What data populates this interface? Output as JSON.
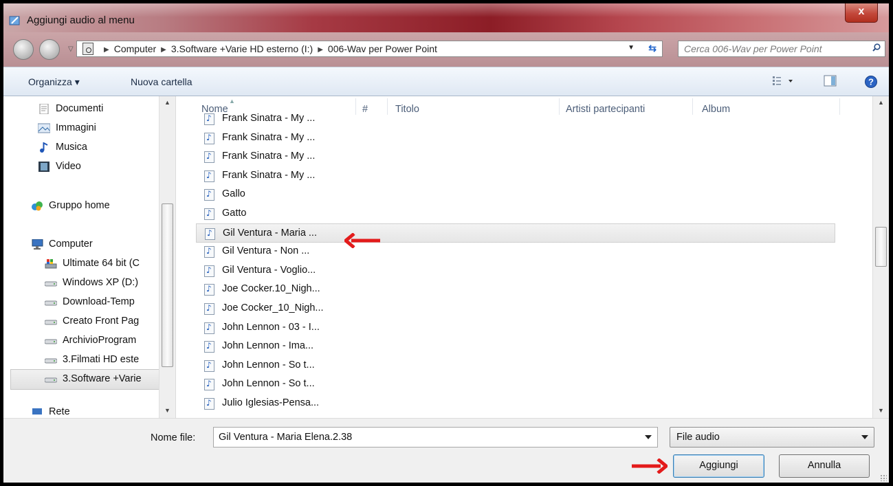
{
  "window": {
    "title": "Aggiungi audio al menu",
    "close_glyph": "x"
  },
  "navigation": {
    "breadcrumbs": [
      "Computer",
      "3.Software +Varie HD esterno (I:)",
      "006-Wav per Power Point"
    ],
    "search_placeholder": "Cerca 006-Wav per Power Point"
  },
  "toolbar": {
    "organize_label": "Organizza ▾",
    "new_folder_label": "Nuova cartella"
  },
  "sidebar": {
    "libraries": [
      "Documenti",
      "Immagini",
      "Musica",
      "Video"
    ],
    "homegroup": "Gruppo home",
    "computer": "Computer",
    "drives": [
      "Ultimate 64 bit (C",
      "Windows XP (D:)",
      "Download-Temp",
      "Creato Front Pag",
      "ArchivioProgram",
      "3.Filmati HD este",
      "3.Software +Varie"
    ],
    "partial_item": "Rete"
  },
  "columns": [
    "Nome",
    "#",
    "Titolo",
    "Artisti partecipanti",
    "Album"
  ],
  "files": [
    "Frank Sinatra - My ...",
    "Frank Sinatra - My ...",
    "Frank Sinatra - My ...",
    "Frank Sinatra - My ...",
    "Gallo",
    "Gatto",
    "Gil Ventura - Maria ...",
    "Gil Ventura - Non ...",
    "Gil Ventura - Voglio...",
    "Joe Cocker.10_Nigh...",
    "Joe Cocker_10_Nigh...",
    "John Lennon - 03 - I...",
    "John Lennon - Ima...",
    "John Lennon - So t...",
    "John Lennon - So t...",
    "Julio Iglesias-Pensa..."
  ],
  "selected_file_index": 6,
  "footer": {
    "filename_label": "Nome file:",
    "filename_value": "Gil Ventura - Maria Elena.2.38",
    "filetype_value": "File audio",
    "add_button": "Aggiungi",
    "cancel_button": "Annulla"
  },
  "colors": {
    "annotation_arrow": "#e31b1b",
    "title_bar": "#8c1d26"
  }
}
